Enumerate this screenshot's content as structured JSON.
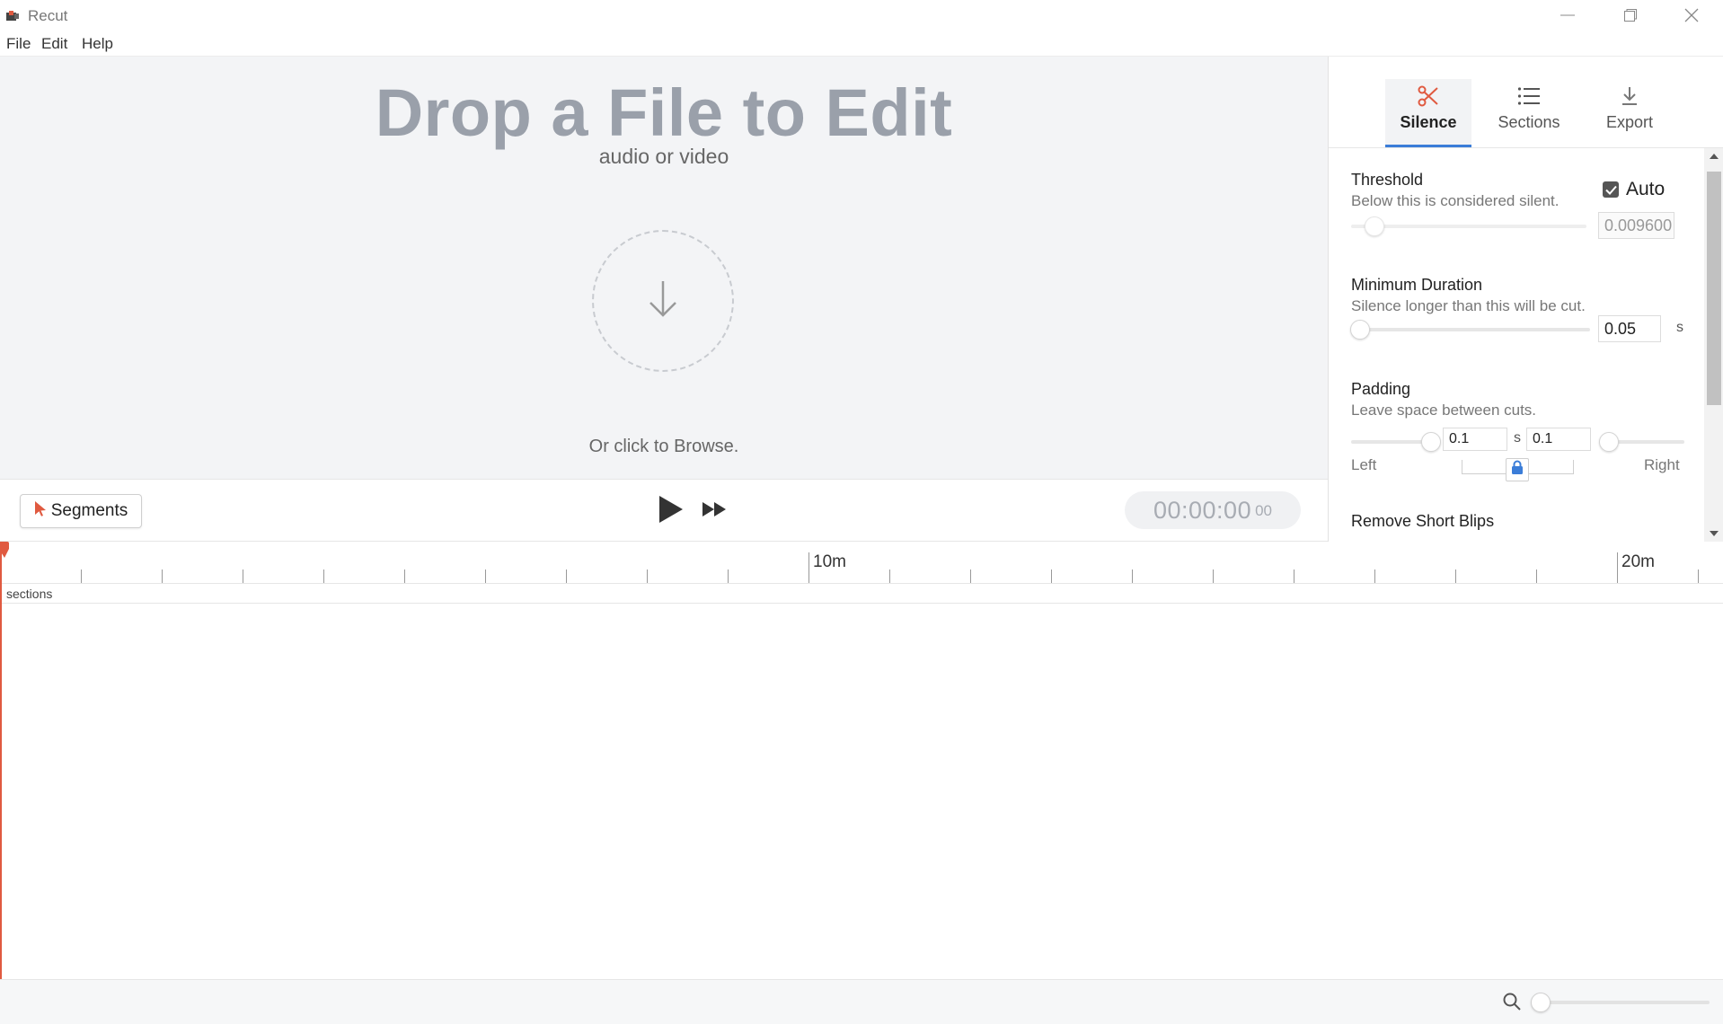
{
  "window": {
    "title": "Recut",
    "logo_icon": "recut-logo-icon",
    "controls": [
      "minimize-icon",
      "restore-icon",
      "close-icon"
    ]
  },
  "menu": {
    "file": "File",
    "edit": "Edit",
    "help": "Help"
  },
  "drop": {
    "title": "Drop a File to Edit",
    "subtitle": "audio or video",
    "icon": "arrow-down-icon",
    "browse": "Or click to Browse."
  },
  "transport": {
    "segments_label": "Segments",
    "segments_icon": "cursor-arrow-icon",
    "play_icon": "play-icon",
    "fast_forward_icon": "fast-forward-icon",
    "timecode": "00:00:00",
    "timecode_frames": "00"
  },
  "tabs": [
    {
      "label": "Silence",
      "icon": "scissors-icon",
      "active": true
    },
    {
      "label": "Sections",
      "icon": "list-icon",
      "active": false
    },
    {
      "label": "Export",
      "icon": "download-icon",
      "active": false
    }
  ],
  "silence": {
    "threshold": {
      "title": "Threshold",
      "desc": "Below this is considered silent.",
      "auto_label": "Auto",
      "auto_checked": true,
      "value": "0.009600",
      "slider_level": 0.07
    },
    "min_duration": {
      "title": "Minimum Duration",
      "desc": "Silence longer than this will be cut.",
      "value": "0.05",
      "unit": "s",
      "slider_level": 0.0
    },
    "padding": {
      "title": "Padding",
      "desc": "Leave space between cuts.",
      "left_value": "0.1",
      "right_value": "0.1",
      "unit": "s",
      "left_label": "Left",
      "right_label": "Right",
      "lock_icon": "lock-icon"
    },
    "remove_short_blips": {
      "title": "Remove Short Blips"
    }
  },
  "timeline": {
    "labels": [
      "10m",
      "20m"
    ],
    "track_label": "sections"
  },
  "zoom": {
    "icon": "magnifier-icon",
    "level": 0.0
  },
  "colors": {
    "accent": "#3b7dd8",
    "playhead": "#e05a40",
    "scissors": "#e05a40"
  }
}
